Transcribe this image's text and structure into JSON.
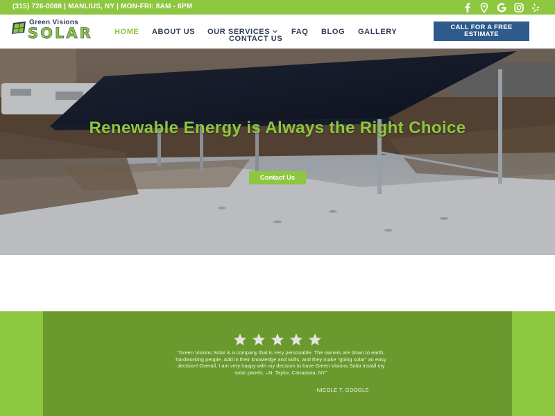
{
  "topbar": {
    "contact_line": "(315) 726-0088 | MANLIUS, NY | MON-FRI: 8AM - 6PM",
    "social_icons": [
      "facebook-icon",
      "map-pin-icon",
      "google-icon",
      "instagram-icon",
      "yelp-icon"
    ]
  },
  "logo": {
    "top_text": "Green Visions",
    "main_text": "SOLAR"
  },
  "nav": {
    "items": [
      {
        "label": "HOME",
        "active": true
      },
      {
        "label": "ABOUT US",
        "active": false
      },
      {
        "label": "OUR SERVICES",
        "active": false,
        "has_dropdown": true
      },
      {
        "label": "FAQ",
        "active": false
      },
      {
        "label": "BLOG",
        "active": false
      },
      {
        "label": "GALLERY",
        "active": false
      },
      {
        "label": "CONTACT US",
        "active": false
      }
    ],
    "cta_label": "CALL FOR A FREE ESTIMATE"
  },
  "hero": {
    "title": "Renewable Energy is Always the Right Choice",
    "button_label": "Contact Us"
  },
  "review": {
    "stars": 5,
    "quote": "“Green Visions Solar is a company that is very personable. The owners are down to earth, hardworking people. Add in their knowledge and skills, and they make “going solar” an easy decision! Overall, I am very happy with my decision to have Green Visions Solar install my solar panels. –N. Taylor, Canastota, NY”",
    "author": "-NICOLE T, GOOGLE"
  },
  "colors": {
    "brand_green": "#8dc63f",
    "dark_green": "#6a9a2e",
    "navy": "#2d3b55",
    "cta_blue": "#2e5a8c"
  }
}
